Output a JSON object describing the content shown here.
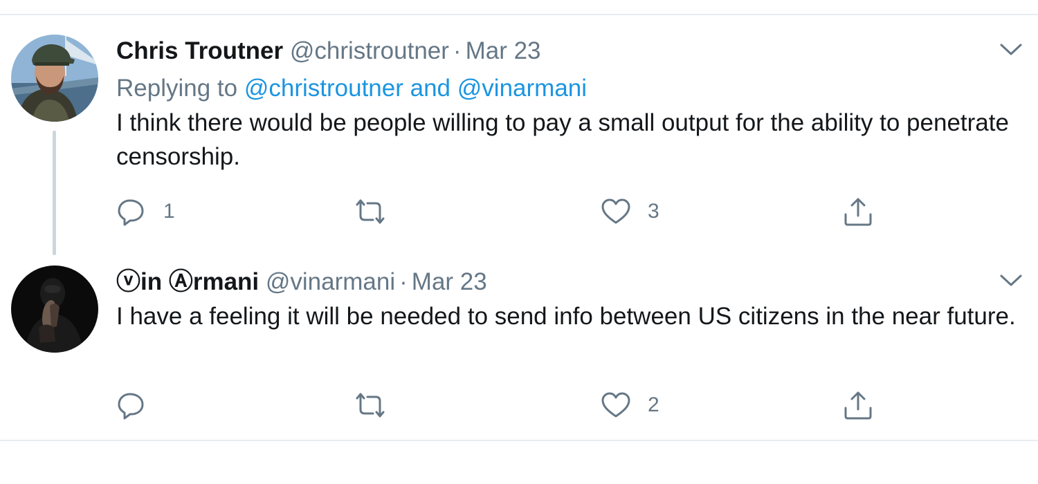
{
  "tweets": [
    {
      "name": "Chris Troutner",
      "handle": "@christroutner",
      "date": "Mar 23",
      "replying_prefix": "Replying to",
      "replying_to": [
        "@christroutner",
        "@vinarmani"
      ],
      "replying_and": "and",
      "text": "I think there would be people willing to pay a small output for the ability to penetrate censorship.",
      "reply_count": "1",
      "retweet_count": "",
      "like_count": "3"
    },
    {
      "name": "ⓥin Ⓐrmani",
      "handle": "@vinarmani",
      "date": "Mar 23",
      "text": "I have a feeling it will be needed to send info between US citizens in the near future.",
      "reply_count": "",
      "retweet_count": "",
      "like_count": "2"
    }
  ],
  "separator": "·",
  "icons": {
    "reply": "reply-icon",
    "retweet": "retweet-icon",
    "like": "heart-icon",
    "share": "share-icon",
    "more": "chevron-down-icon"
  },
  "colors": {
    "text": "#14171a",
    "secondary": "#657786",
    "link": "#1b95e0",
    "divider": "#e6ecf0",
    "thread": "#ccd6dd"
  }
}
